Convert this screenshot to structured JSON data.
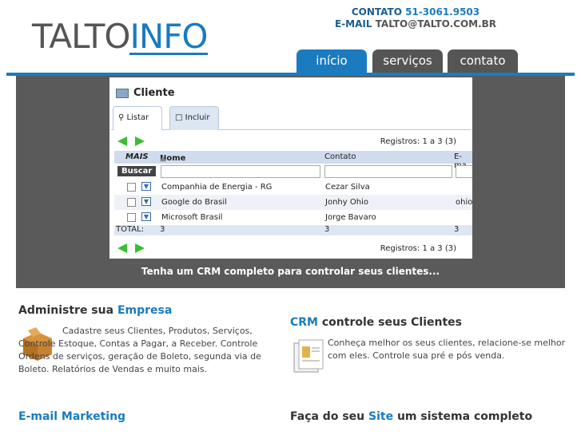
{
  "header": {
    "logo_part1": "TALTO",
    "logo_part2": "INFO",
    "contact_label": "CONTATO",
    "contact_phone": "51-3061.9503",
    "email_label": "E-MAIL",
    "email_value": "TALTO@TALTO.COM.BR"
  },
  "nav": {
    "tabs": [
      {
        "label": "início"
      },
      {
        "label": "serviços"
      },
      {
        "label": "contato"
      }
    ]
  },
  "banner": {
    "app_title": "Cliente",
    "tab_list": "Listar",
    "tab_include": "Incluir",
    "registros_top": "Registros: 1 a 3 (3)",
    "registros_bottom": "Registros: 1 a 3 (3)",
    "columns": {
      "mais": "MAIS",
      "nome": "Nome",
      "contato": "Contato",
      "email": "E-ma"
    },
    "search_button": "Buscar",
    "rows": [
      {
        "nome": "Companhia de Energia - RG",
        "contato": "Cezar Silva",
        "email": ""
      },
      {
        "nome": "Google do Brasil",
        "contato": "Jonhy Ohio",
        "email": "ohio"
      },
      {
        "nome": "Microsoft Brasil",
        "contato": "Jorge Bavaro",
        "email": ""
      }
    ],
    "total_label": "TOTAL:",
    "total_nome": "3",
    "total_contato": "3",
    "total_email": "3",
    "caption": "Tenha um CRM completo para controlar seus clientes..."
  },
  "sections": {
    "s1": {
      "title_plain": "Administre sua ",
      "title_highlight": "Empresa",
      "text": "Cadastre seus Clientes, Produtos, Serviços, Controle Estoque, Contas a Pagar, a Receber. Controle Ordens de serviços, geração de Boleto, segunda via de Boleto. Relatórios de Vendas e muito mais."
    },
    "s2": {
      "title_highlight": "CRM",
      "title_plain": " controle seus Clientes",
      "text": "Conheça melhor os seus clientes, relacione-se melhor com eles. Controle sua pré e pós venda."
    },
    "s3": {
      "title_highlight": "E-mail Marketing"
    },
    "s4": {
      "title_plain1": "Faça do seu ",
      "title_highlight": "Site",
      "title_plain2": " um sistema completo"
    }
  }
}
